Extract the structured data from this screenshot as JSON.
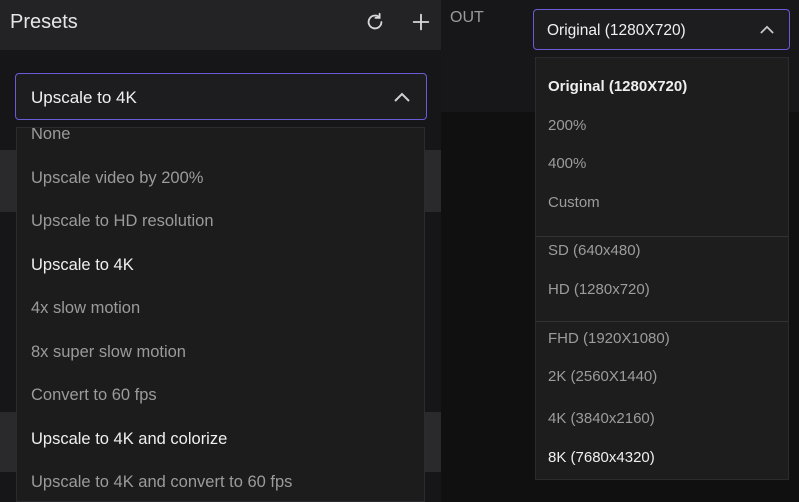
{
  "presets": {
    "title": "Presets",
    "icons": [
      "refresh-icon",
      "plus-icon"
    ],
    "selected": "Upscale to 4K",
    "options": [
      {
        "label": "None"
      },
      {
        "label": "Upscale video by 200%"
      },
      {
        "label": "Upscale to HD resolution"
      },
      {
        "label": "Upscale to 4K"
      },
      {
        "label": "4x slow motion"
      },
      {
        "label": "8x super slow motion"
      },
      {
        "label": "Convert to 60 fps"
      },
      {
        "label": "Upscale to 4K and colorize"
      },
      {
        "label": "Upscale to 4K and convert to 60 fps"
      }
    ]
  },
  "output": {
    "label": "OUT",
    "selected": "Original (1280X720)",
    "options": [
      {
        "label": "Original (1280X720)"
      },
      {
        "label": "200%"
      },
      {
        "label": "400%"
      },
      {
        "label": "Custom"
      },
      {
        "label": "SD (640x480)"
      },
      {
        "label": "HD (1280x720)"
      },
      {
        "label": "FHD (1920X1080)"
      },
      {
        "label": "2K (2560X1440)"
      },
      {
        "label": "4K (3840x2160)"
      },
      {
        "label": "8K (7680x4320)"
      }
    ]
  },
  "colors": {
    "accent": "#6a5bd6",
    "panel": "#161618",
    "header": "#232325"
  }
}
